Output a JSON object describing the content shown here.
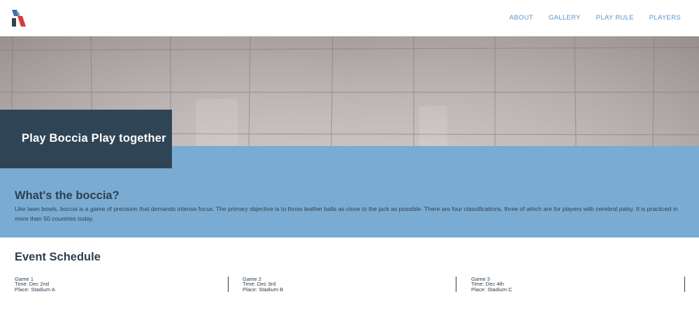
{
  "nav": {
    "items": [
      {
        "label": "ABOUT"
      },
      {
        "label": "GALLERY"
      },
      {
        "label": "PLAY RULE"
      },
      {
        "label": "PLAYERS"
      }
    ]
  },
  "hero": {
    "title": "Play Boccia Play together"
  },
  "about": {
    "heading": "What's the boccia?",
    "text": "Like lawn bowls, boccia is a game of precision that demands intense focus. The primary objective is to throw leather balls as close to the jack as possible. There are four classifications, three of which are for players with cerebral palsy. It is practiced in more than 50 countries today."
  },
  "schedule": {
    "heading": "Event Schedule",
    "games": [
      {
        "name": "Game 1",
        "time": "Time: Dec 2nd",
        "place": "Place: Stadium A"
      },
      {
        "name": "Game 2",
        "time": "Time: Dec 3rd",
        "place": "Place: Stadium B"
      },
      {
        "name": "Game 3",
        "time": "Time: Dec 4th",
        "place": "Place: Stadium C"
      }
    ]
  },
  "colors": {
    "nav_link": "#5a95c8",
    "title_box": "#2f4556",
    "about_band": "#7aacd3",
    "text_dark": "#2e3f4f",
    "logo_red": "#d9393b",
    "logo_blue": "#3e6fa8"
  }
}
